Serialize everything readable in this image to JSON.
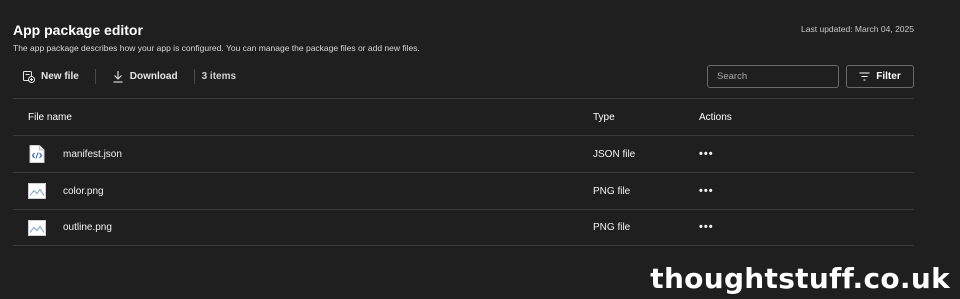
{
  "header": {
    "title": "App package editor",
    "subtitle": "The app package describes how your app is configured. You can manage the package files or add new files.",
    "last_updated": "Last updated: March 04, 2025"
  },
  "toolbar": {
    "new_file_label": "New file",
    "download_label": "Download",
    "item_count": "3 items"
  },
  "search": {
    "placeholder": "Search"
  },
  "filter": {
    "label": "Filter"
  },
  "table": {
    "columns": {
      "name": "File name",
      "type": "Type",
      "actions": "Actions"
    },
    "rows": [
      {
        "name": "manifest.json",
        "type": "JSON file",
        "icon": "json-file-icon",
        "actions": "•••"
      },
      {
        "name": "color.png",
        "type": "PNG file",
        "icon": "image-file-icon",
        "actions": "•••"
      },
      {
        "name": "outline.png",
        "type": "PNG file",
        "icon": "image-file-icon",
        "actions": "•••"
      }
    ]
  },
  "watermark": "thoughtstuff.co.uk",
  "colors": {
    "background": "#1f1f1f",
    "text": "#ffffff",
    "border": "#3a3a3a"
  }
}
